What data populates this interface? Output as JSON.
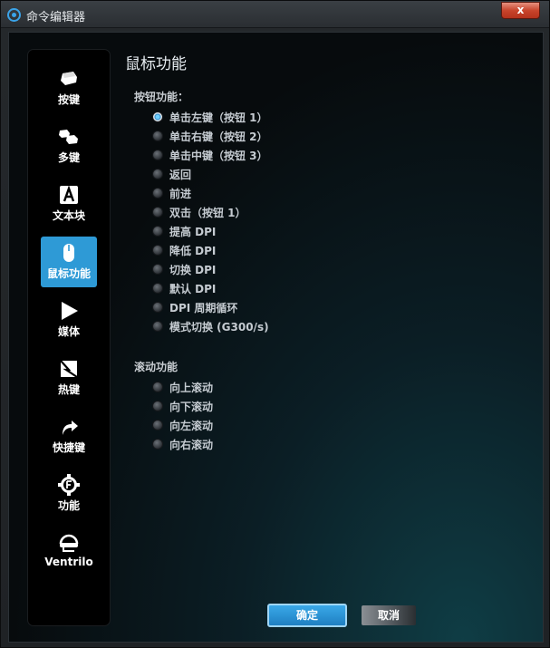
{
  "window": {
    "title": "命令编辑器",
    "close_label": "x"
  },
  "sidebar": {
    "items": [
      {
        "label": "按键",
        "icon": "key-icon",
        "active": false
      },
      {
        "label": "多键",
        "icon": "multi-key-icon",
        "active": false
      },
      {
        "label": "文本块",
        "icon": "text-block-icon",
        "active": false
      },
      {
        "label": "鼠标功能",
        "icon": "mouse-icon",
        "active": true
      },
      {
        "label": "媒体",
        "icon": "play-icon",
        "active": false
      },
      {
        "label": "热键",
        "icon": "hotkey-icon",
        "active": false
      },
      {
        "label": "快捷键",
        "icon": "shortcut-arrow-icon",
        "active": false
      },
      {
        "label": "功能",
        "icon": "function-gear-icon",
        "active": false
      },
      {
        "label": "Ventrilo",
        "icon": "headset-icon",
        "active": false
      }
    ]
  },
  "main": {
    "heading": "鼠标功能",
    "button_section": {
      "title": "按钮功能：",
      "options": [
        {
          "label": "单击左键（按钮 1）",
          "checked": true
        },
        {
          "label": "单击右键（按钮 2）",
          "checked": false
        },
        {
          "label": "单击中键（按钮 3）",
          "checked": false
        },
        {
          "label": "返回",
          "checked": false
        },
        {
          "label": "前进",
          "checked": false
        },
        {
          "label": "双击（按钮 1）",
          "checked": false
        },
        {
          "label": "提高 DPI",
          "checked": false
        },
        {
          "label": "降低 DPI",
          "checked": false
        },
        {
          "label": "切换 DPI",
          "checked": false
        },
        {
          "label": "默认 DPI",
          "checked": false
        },
        {
          "label": "DPI 周期循环",
          "checked": false
        },
        {
          "label": "模式切换 (G300/s)",
          "checked": false
        }
      ]
    },
    "scroll_section": {
      "title": "滚动功能",
      "options": [
        {
          "label": "向上滚动",
          "checked": false
        },
        {
          "label": "向下滚动",
          "checked": false
        },
        {
          "label": "向左滚动",
          "checked": false
        },
        {
          "label": "向右滚动",
          "checked": false
        }
      ]
    }
  },
  "footer": {
    "ok_label": "确定",
    "cancel_label": "取消"
  },
  "colors": {
    "accent": "#2e9ad6",
    "background": "#05080a"
  }
}
